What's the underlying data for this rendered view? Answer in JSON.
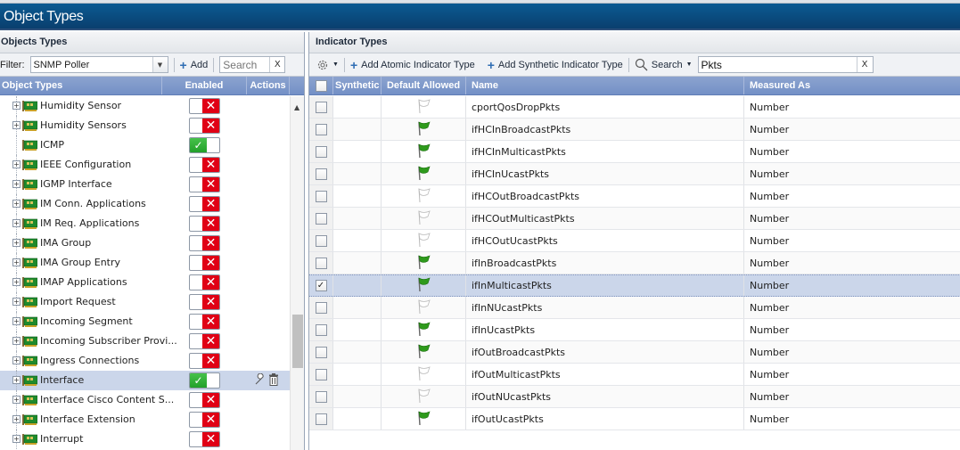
{
  "window": {
    "title": "Object Types"
  },
  "left_panel": {
    "title": "Objects Types",
    "filter_label": "Filter:",
    "filter_value": "SNMP Poller",
    "add_label": "Add",
    "search_placeholder": "Search",
    "clear_label": "X",
    "columns": [
      "Object Types",
      "Enabled",
      "Actions"
    ],
    "rows": [
      {
        "name": "Humidity Sensor",
        "expandable": true,
        "enabled": false,
        "selected": false
      },
      {
        "name": "Humidity Sensors",
        "expandable": true,
        "enabled": false,
        "selected": false
      },
      {
        "name": "ICMP",
        "expandable": false,
        "enabled": true,
        "selected": false
      },
      {
        "name": "IEEE Configuration",
        "expandable": true,
        "enabled": false,
        "selected": false
      },
      {
        "name": "IGMP Interface",
        "expandable": true,
        "enabled": false,
        "selected": false
      },
      {
        "name": "IM Conn. Applications",
        "expandable": true,
        "enabled": false,
        "selected": false
      },
      {
        "name": "IM Req. Applications",
        "expandable": true,
        "enabled": false,
        "selected": false
      },
      {
        "name": "IMA Group",
        "expandable": true,
        "enabled": false,
        "selected": false
      },
      {
        "name": "IMA Group Entry",
        "expandable": true,
        "enabled": false,
        "selected": false
      },
      {
        "name": "IMAP Applications",
        "expandable": true,
        "enabled": false,
        "selected": false
      },
      {
        "name": "Import Request",
        "expandable": true,
        "enabled": false,
        "selected": false
      },
      {
        "name": "Incoming Segment",
        "expandable": true,
        "enabled": false,
        "selected": false
      },
      {
        "name": "Incoming Subscriber Provi...",
        "expandable": true,
        "enabled": false,
        "selected": false
      },
      {
        "name": "Ingress Connections",
        "expandable": true,
        "enabled": false,
        "selected": false
      },
      {
        "name": "Interface",
        "expandable": true,
        "enabled": true,
        "selected": true
      },
      {
        "name": "Interface Cisco Content S...",
        "expandable": true,
        "enabled": false,
        "selected": false
      },
      {
        "name": "Interface Extension",
        "expandable": true,
        "enabled": false,
        "selected": false
      },
      {
        "name": "Interrupt",
        "expandable": true,
        "enabled": false,
        "selected": false
      }
    ],
    "icons": {
      "edit": "wrench-icon",
      "delete": "trash-icon",
      "expand": "plus-box-icon",
      "device": "network-card-icon"
    }
  },
  "right_panel": {
    "title": "Indicator Types",
    "toolbar": {
      "settings_icon": "gear-icon",
      "add_atomic": "Add Atomic Indicator Type",
      "add_synthetic": "Add Synthetic Indicator Type",
      "search_label": "Search",
      "search_value": "Pkts",
      "clear_label": "X"
    },
    "columns": [
      "Synthetic",
      "Default Allowed",
      "Name",
      "Measured As"
    ],
    "rows": [
      {
        "checked": false,
        "synthetic": "",
        "default_allowed": false,
        "name": "cportQosDropPkts",
        "measured_as": "Number"
      },
      {
        "checked": false,
        "synthetic": "",
        "default_allowed": true,
        "name": "ifHCInBroadcastPkts",
        "measured_as": "Number"
      },
      {
        "checked": false,
        "synthetic": "",
        "default_allowed": true,
        "name": "ifHCInMulticastPkts",
        "measured_as": "Number"
      },
      {
        "checked": false,
        "synthetic": "",
        "default_allowed": true,
        "name": "ifHCInUcastPkts",
        "measured_as": "Number"
      },
      {
        "checked": false,
        "synthetic": "",
        "default_allowed": false,
        "name": "ifHCOutBroadcastPkts",
        "measured_as": "Number"
      },
      {
        "checked": false,
        "synthetic": "",
        "default_allowed": false,
        "name": "ifHCOutMulticastPkts",
        "measured_as": "Number"
      },
      {
        "checked": false,
        "synthetic": "",
        "default_allowed": false,
        "name": "ifHCOutUcastPkts",
        "measured_as": "Number"
      },
      {
        "checked": false,
        "synthetic": "",
        "default_allowed": true,
        "name": "ifInBroadcastPkts",
        "measured_as": "Number"
      },
      {
        "checked": true,
        "synthetic": "",
        "default_allowed": true,
        "name": "ifInMulticastPkts",
        "measured_as": "Number"
      },
      {
        "checked": false,
        "synthetic": "",
        "default_allowed": false,
        "name": "ifInNUcastPkts",
        "measured_as": "Number"
      },
      {
        "checked": false,
        "synthetic": "",
        "default_allowed": true,
        "name": "ifInUcastPkts",
        "measured_as": "Number"
      },
      {
        "checked": false,
        "synthetic": "",
        "default_allowed": true,
        "name": "ifOutBroadcastPkts",
        "measured_as": "Number"
      },
      {
        "checked": false,
        "synthetic": "",
        "default_allowed": false,
        "name": "ifOutMulticastPkts",
        "measured_as": "Number"
      },
      {
        "checked": false,
        "synthetic": "",
        "default_allowed": false,
        "name": "ifOutNUcastPkts",
        "measured_as": "Number"
      },
      {
        "checked": false,
        "synthetic": "",
        "default_allowed": true,
        "name": "ifOutUcastPkts",
        "measured_as": "Number"
      }
    ]
  },
  "colors": {
    "title_bar": "#0a4f84",
    "grid_header": "#7f9acb",
    "selection": "#cbd6ea",
    "enabled_green": "#2eaa33",
    "disabled_red": "#e00015",
    "flag_green": "#2e9a1c"
  }
}
